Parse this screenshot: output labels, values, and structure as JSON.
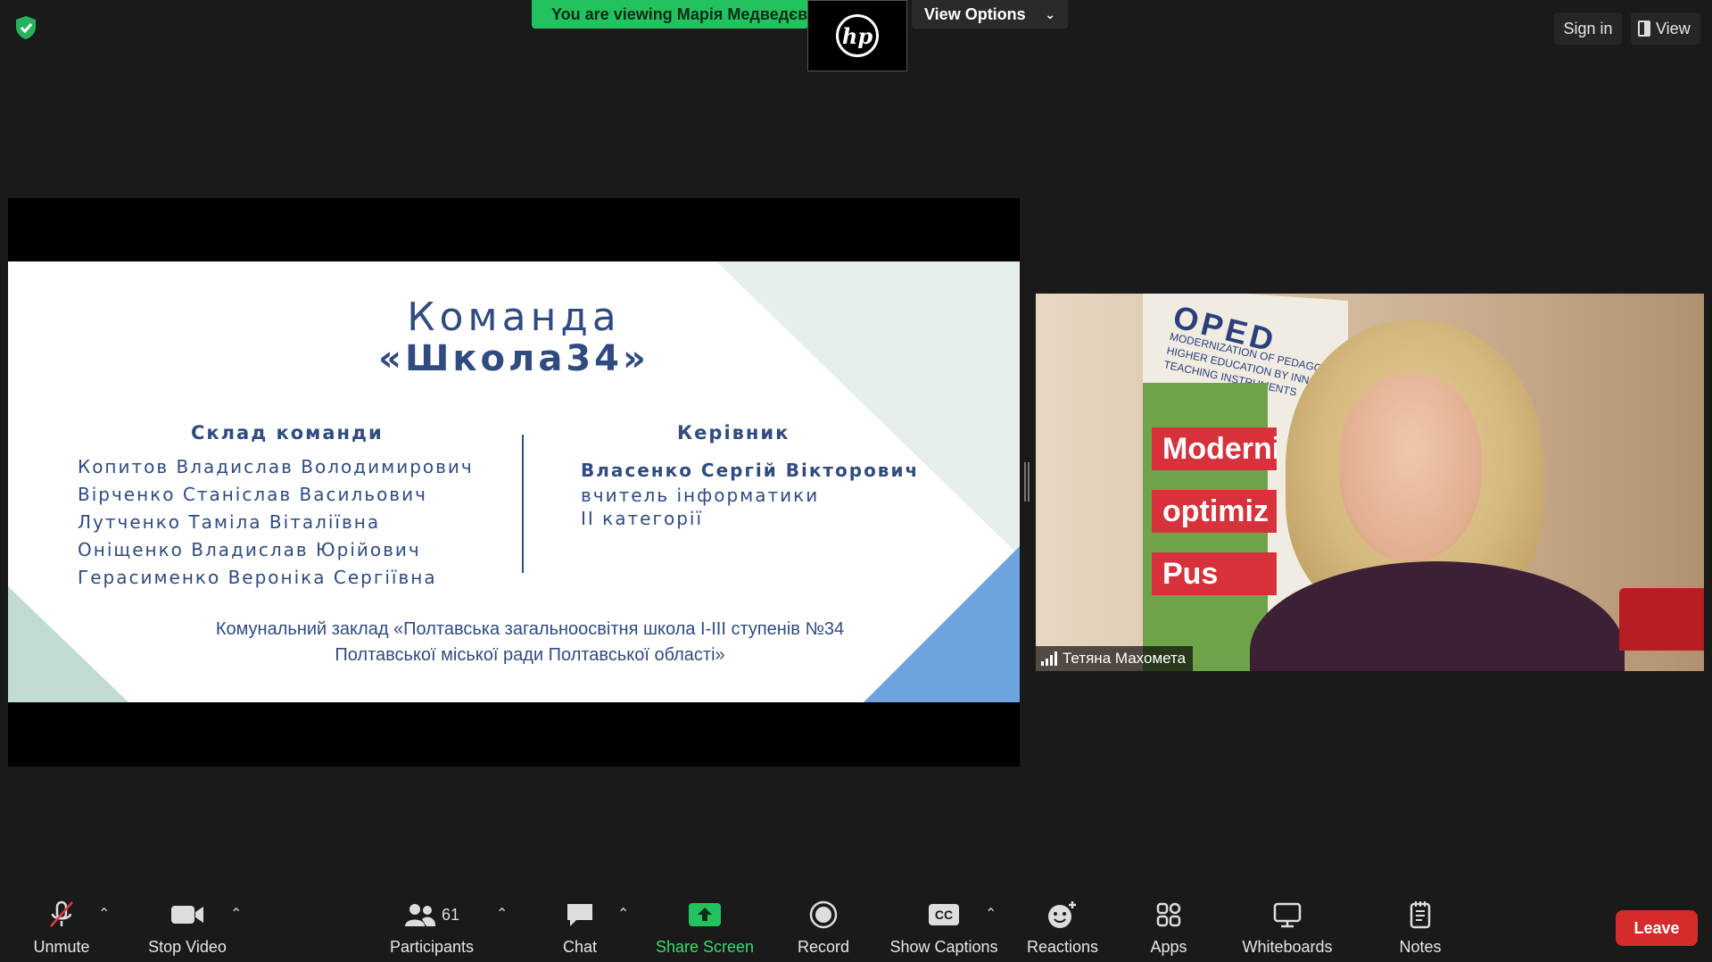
{
  "top_bar": {
    "viewing_banner": "You are viewing Марія Медведєва's screen",
    "sharer_logo": "hp",
    "view_options_label": "View Options",
    "sign_in_label": "Sign in",
    "view_label": "View",
    "security_icon": "shield-check-icon",
    "accent_green": "#22c35e"
  },
  "slide": {
    "title": "Команда",
    "subtitle": "«Школа34»",
    "team_heading": "Склад команди",
    "members": [
      "Копитов Владислав Володимирович",
      "Вірченко Станіслав Васильович",
      "Лутченко Таміла Віталіївна",
      "Оніщенко Владислав Юрійович",
      "Герасименко Вероніка Сергіївна"
    ],
    "leader_heading": "Керівник",
    "leader_name": "Власенко Сергій Вікторович",
    "leader_role_1": "вчитель інформатики",
    "leader_role_2": "ІІ категорії",
    "institution_line_1": "Комунальний заклад «Полтавська загальноосвітня школа І-ІІІ ступенів №34",
    "institution_line_2": "Полтавської міської ради Полтавської області»"
  },
  "participant_video": {
    "name": "Тетяна Махомета",
    "banner_logo": "OPED",
    "banner_lines": [
      "MODERNIZATION OF PEDAGOGICAL",
      "HIGHER EDUCATION BY INNOVATIVE",
      "TEACHING INSTRUMENTS"
    ],
    "banner_words": [
      "Moderniz",
      "optimiz",
      "Pus"
    ]
  },
  "toolbar": {
    "unmute": "Unmute",
    "stop_video": "Stop Video",
    "participants": "Participants",
    "participants_count": "61",
    "chat": "Chat",
    "share_screen": "Share Screen",
    "record": "Record",
    "show_captions": "Show Captions",
    "captions_badge": "CC",
    "reactions": "Reactions",
    "apps": "Apps",
    "whiteboards": "Whiteboards",
    "notes": "Notes",
    "leave": "Leave",
    "leave_color": "#d72b2b",
    "share_color": "#3ddb6f"
  }
}
